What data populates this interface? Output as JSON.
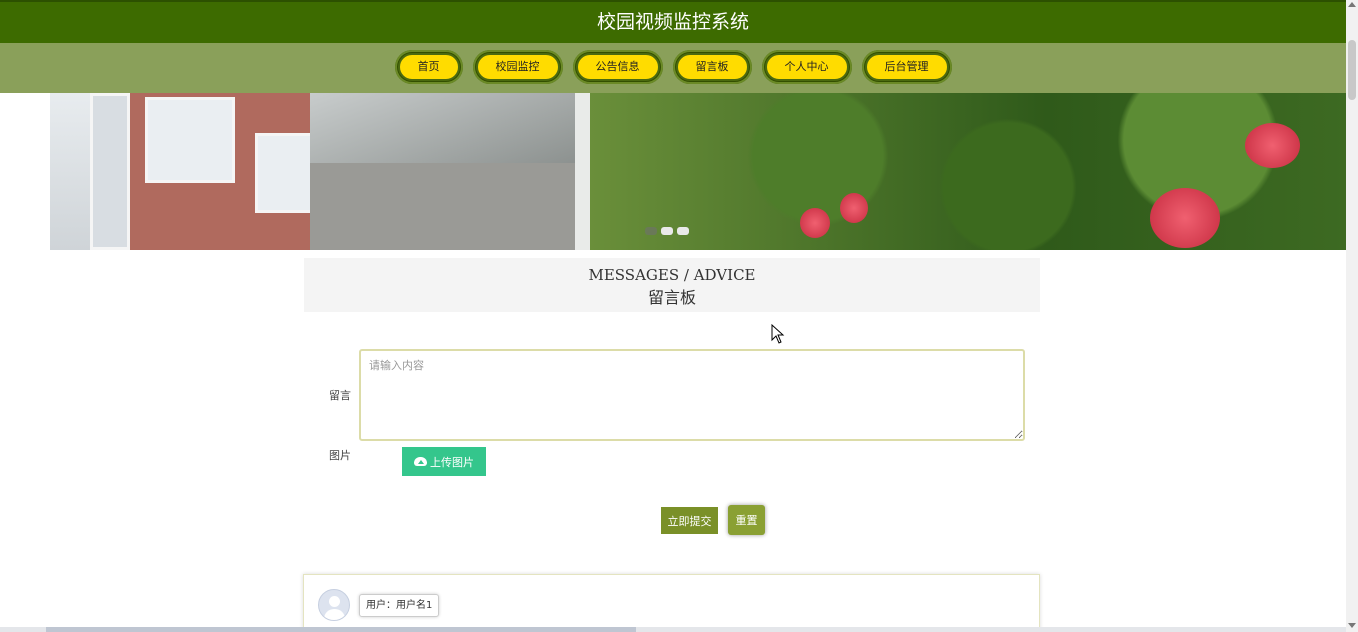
{
  "header": {
    "title": "校园视频监控系统"
  },
  "nav": {
    "items": [
      {
        "label": "首页"
      },
      {
        "label": "校园监控"
      },
      {
        "label": "公告信息"
      },
      {
        "label": "留言板"
      },
      {
        "label": "个人中心"
      },
      {
        "label": "后台管理"
      }
    ]
  },
  "banner": {
    "slide_count": 3,
    "active_slide": 1
  },
  "section": {
    "title_en": "MESSAGES / ADVICE",
    "title_cn": "留言板"
  },
  "form": {
    "message_label": "留言",
    "message_placeholder": "请输入内容",
    "message_value": "",
    "image_label": "图片",
    "upload_label": "上传图片",
    "submit_label": "立即提交",
    "reset_label": "重置"
  },
  "messages": [
    {
      "user": "用户：用户名1"
    }
  ],
  "icons": {
    "upload": "cloud-upload-icon",
    "avatar": "user-avatar-icon"
  },
  "colors": {
    "header_bg": "#3d6b00",
    "nav_bg": "#8aa05a",
    "nav_button": "#ffdc00",
    "upload_button": "#34c68c",
    "submit_button": "#7a9028"
  }
}
